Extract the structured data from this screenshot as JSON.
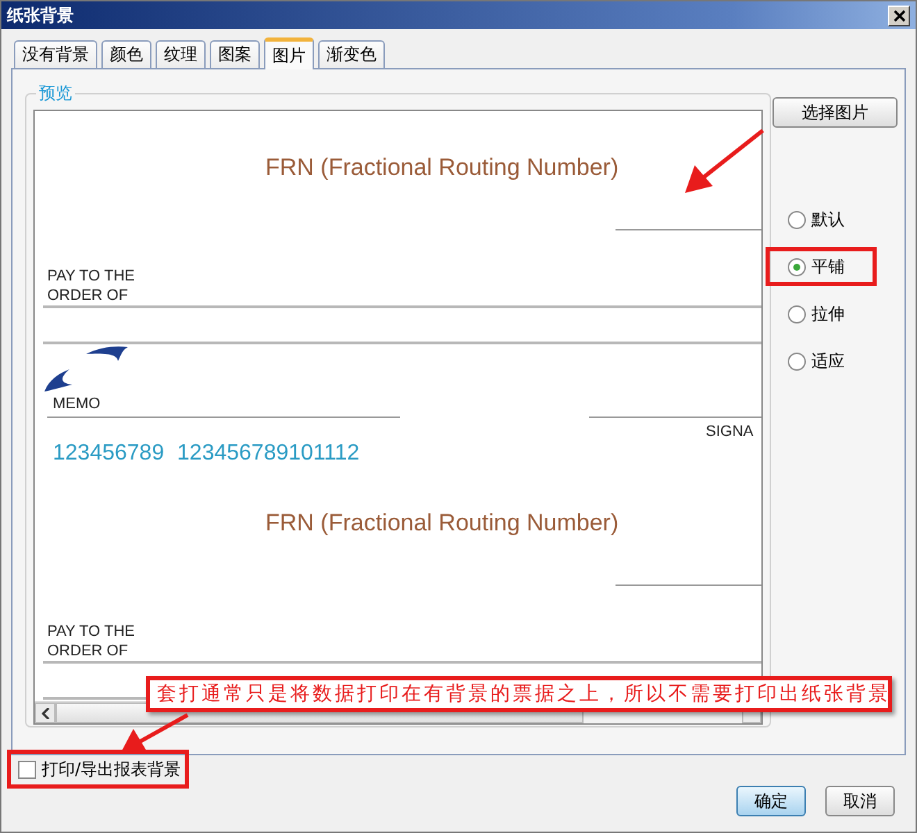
{
  "window": {
    "title": "纸张背景"
  },
  "tabs": [
    {
      "label": "没有背景",
      "selected": false
    },
    {
      "label": "颜色",
      "selected": false
    },
    {
      "label": "纹理",
      "selected": false
    },
    {
      "label": "图案",
      "selected": false
    },
    {
      "label": "图片",
      "selected": true
    },
    {
      "label": "渐变色",
      "selected": false
    }
  ],
  "preview": {
    "legend": "预览",
    "tiles": [
      {
        "title": "FRN (Fractional Routing Number)",
        "pay_to": "PAY TO THE",
        "order_of": "ORDER OF",
        "memo": "MEMO",
        "signature": "SIGNA",
        "micr": "123456789 123456789101112"
      },
      {
        "title": "FRN (Fractional Routing Number)",
        "pay_to": "PAY TO THE",
        "order_of": "ORDER OF"
      }
    ]
  },
  "choose_button": "选择图片",
  "radios": [
    {
      "label": "默认",
      "selected": false,
      "highlighted": false
    },
    {
      "label": "平铺",
      "selected": true,
      "highlighted": true
    },
    {
      "label": "拉伸",
      "selected": false,
      "highlighted": false
    },
    {
      "label": "适应",
      "selected": false,
      "highlighted": false
    }
  ],
  "print_background": {
    "label": "打印/导出报表背景",
    "checked": false,
    "highlighted": true
  },
  "buttons": [
    {
      "label": "确定",
      "default": true
    },
    {
      "label": "取消",
      "default": false
    }
  ],
  "annotation": {
    "note": "套打通常只是将数据打印在有背景的票据之上，所以不需要打印出纸张背景"
  }
}
